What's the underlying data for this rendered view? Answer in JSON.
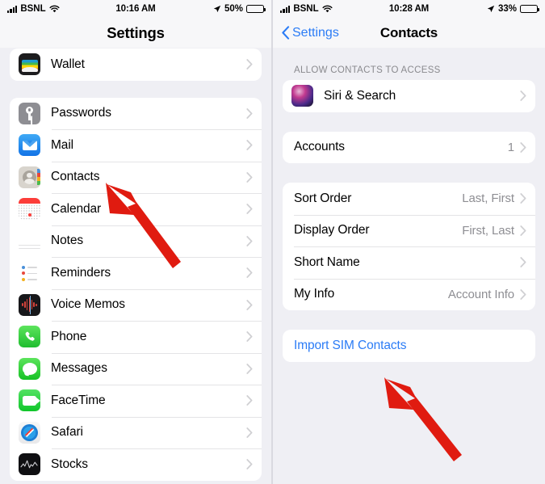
{
  "left_panel": {
    "status_bar": {
      "carrier": "BSNL",
      "time": "10:16 AM",
      "battery_percent": "50%",
      "signal_icon": "cellular-bars-icon",
      "wifi_icon": "wifi-icon",
      "location_icon": "location-arrow-icon",
      "battery_icon": "battery-icon"
    },
    "nav": {
      "title": "Settings"
    },
    "groups": [
      {
        "rows": [
          {
            "label": "Wallet",
            "icon": "wallet-app-icon",
            "accessory": "chevron-right-icon"
          }
        ]
      },
      {
        "rows": [
          {
            "label": "Passwords",
            "icon": "passwords-app-icon",
            "accessory": "chevron-right-icon"
          },
          {
            "label": "Mail",
            "icon": "mail-app-icon",
            "accessory": "chevron-right-icon"
          },
          {
            "label": "Contacts",
            "icon": "contacts-app-icon",
            "accessory": "chevron-right-icon"
          },
          {
            "label": "Calendar",
            "icon": "calendar-app-icon",
            "accessory": "chevron-right-icon"
          },
          {
            "label": "Notes",
            "icon": "notes-app-icon",
            "accessory": "chevron-right-icon"
          },
          {
            "label": "Reminders",
            "icon": "reminders-app-icon",
            "accessory": "chevron-right-icon"
          },
          {
            "label": "Voice Memos",
            "icon": "voice-memos-app-icon",
            "accessory": "chevron-right-icon"
          },
          {
            "label": "Phone",
            "icon": "phone-app-icon",
            "accessory": "chevron-right-icon"
          },
          {
            "label": "Messages",
            "icon": "messages-app-icon",
            "accessory": "chevron-right-icon"
          },
          {
            "label": "FaceTime",
            "icon": "facetime-app-icon",
            "accessory": "chevron-right-icon"
          },
          {
            "label": "Safari",
            "icon": "safari-app-icon",
            "accessory": "chevron-right-icon"
          },
          {
            "label": "Stocks",
            "icon": "stocks-app-icon",
            "accessory": "chevron-right-icon"
          }
        ]
      }
    ],
    "annotation": {
      "arrow_color": "#e01b10",
      "points_to": "Contacts"
    }
  },
  "right_panel": {
    "status_bar": {
      "carrier": "BSNL",
      "time": "10:28 AM",
      "battery_percent": "33%",
      "signal_icon": "cellular-bars-icon",
      "wifi_icon": "wifi-icon",
      "location_icon": "location-arrow-icon",
      "battery_icon": "battery-icon"
    },
    "nav": {
      "back_label": "Settings",
      "title": "Contacts",
      "back_icon": "chevron-left-icon"
    },
    "section_header": "ALLOW CONTACTS TO ACCESS",
    "access_group": [
      {
        "label": "Siri & Search",
        "icon": "siri-app-icon",
        "accessory": "chevron-right-icon"
      }
    ],
    "accounts_group": [
      {
        "label": "Accounts",
        "value": "1",
        "accessory": "chevron-right-icon"
      }
    ],
    "options_group": [
      {
        "label": "Sort Order",
        "value": "Last, First",
        "accessory": "chevron-right-icon"
      },
      {
        "label": "Display Order",
        "value": "First, Last",
        "accessory": "chevron-right-icon"
      },
      {
        "label": "Short Name",
        "value": "",
        "accessory": "chevron-right-icon"
      },
      {
        "label": "My Info",
        "value": "Account Info",
        "accessory": "chevron-right-icon"
      }
    ],
    "action_group": [
      {
        "label": "Import SIM Contacts"
      }
    ],
    "annotation": {
      "arrow_color": "#e01b10",
      "points_to": "Import SIM Contacts"
    }
  },
  "colors": {
    "accent_blue": "#2b7cf6",
    "page_background": "#efeff4",
    "card_background": "#ffffff",
    "secondary_text": "#8e8e93",
    "arrow_red": "#e01b10"
  }
}
